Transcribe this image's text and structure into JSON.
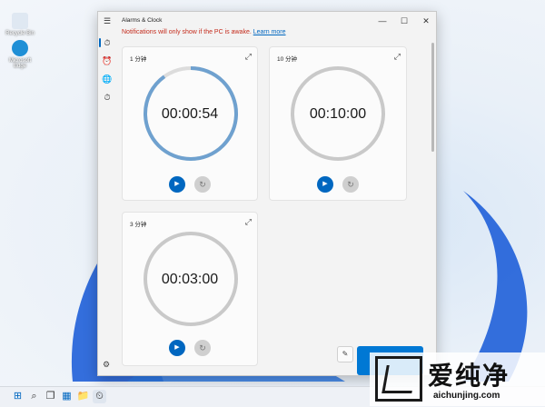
{
  "desktop": {
    "icons": [
      {
        "label": "Recycle Bin",
        "color": "#dfe8f2"
      },
      {
        "label": "Microsoft Edge",
        "color": "#1f8fd6"
      }
    ]
  },
  "window": {
    "title": "Alarms & Clock",
    "controls": {
      "minimize": "—",
      "maximize": "☐",
      "close": "✕"
    },
    "notice": {
      "text": "Notifications will only show if the PC is awake.",
      "link": "Learn more"
    }
  },
  "nav": [
    {
      "icon": "hamburger-menu-icon",
      "glyph": "☰"
    },
    {
      "icon": "timer-icon",
      "glyph": "⏱",
      "selected": true
    },
    {
      "icon": "alarm-icon",
      "glyph": "⏰"
    },
    {
      "icon": "world-clock-icon",
      "glyph": "🌐"
    },
    {
      "icon": "stopwatch-icon",
      "glyph": "⏱"
    }
  ],
  "timers": [
    {
      "name": "1 分钟",
      "time": "00:00:54",
      "progress": 0.9,
      "active": true
    },
    {
      "name": "10 分钟",
      "time": "00:10:00",
      "progress": 0,
      "active": false
    },
    {
      "name": "3 分钟",
      "time": "00:03:00",
      "progress": 0,
      "active": false
    }
  ],
  "icons": {
    "expand": "⤢",
    "play": "▶",
    "reset": "↻",
    "edit": "✎",
    "settings": "⚙"
  },
  "colors": {
    "accent": "#0067c0",
    "ring_active": "#6fa1cf",
    "ring_idle": "#c9c9c9",
    "notice": "#c42b1c"
  },
  "taskbar": [
    {
      "icon": "start-icon",
      "glyph": "⊞"
    },
    {
      "icon": "search-icon",
      "glyph": "⌕"
    },
    {
      "icon": "task-view-icon",
      "glyph": "❐"
    },
    {
      "icon": "widgets-icon",
      "glyph": "▦"
    },
    {
      "icon": "file-explorer-icon",
      "glyph": "📁"
    },
    {
      "icon": "alarms-clock-icon",
      "glyph": "⏲"
    }
  ],
  "watermark": {
    "cn": "爱纯净",
    "url": "aichunjing.com"
  }
}
